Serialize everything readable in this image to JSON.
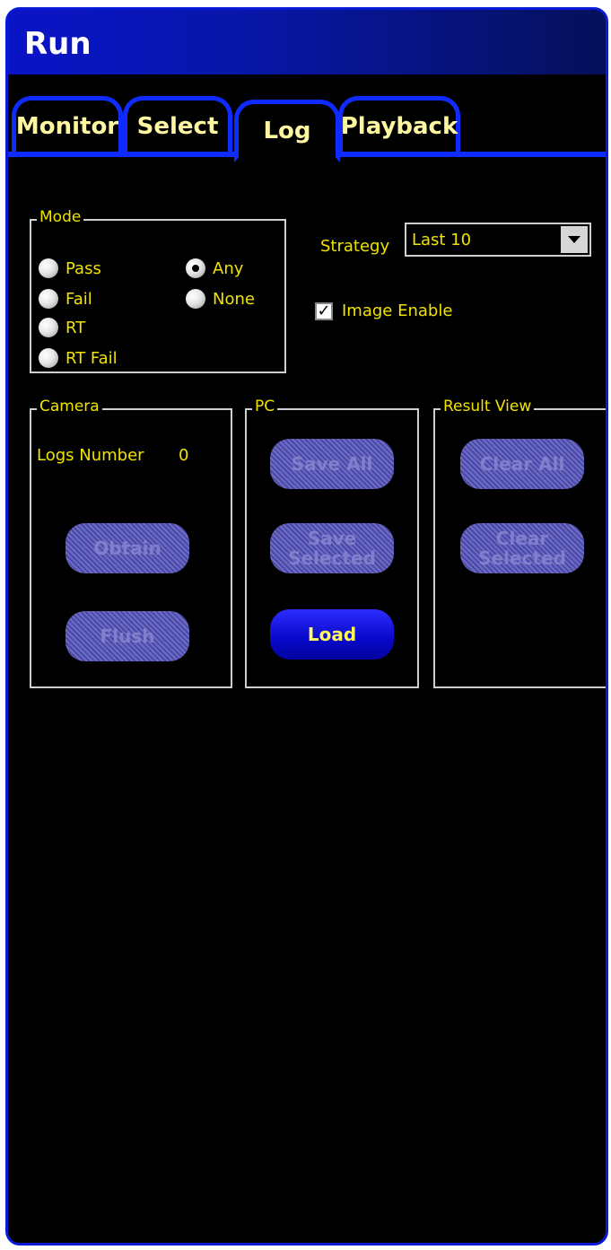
{
  "window": {
    "title": "Run"
  },
  "tabs": [
    {
      "label": "Monitor",
      "active": false
    },
    {
      "label": "Select",
      "active": false
    },
    {
      "label": "Log",
      "active": true
    },
    {
      "label": "Playback",
      "active": false
    }
  ],
  "mode": {
    "label": "Mode",
    "options": [
      {
        "label": "Pass",
        "selected": false
      },
      {
        "label": "Fail",
        "selected": false
      },
      {
        "label": "RT",
        "selected": false
      },
      {
        "label": "RT Fail",
        "selected": false
      },
      {
        "label": "Any",
        "selected": true
      },
      {
        "label": "None",
        "selected": false
      }
    ]
  },
  "strategy": {
    "label": "Strategy",
    "value": "Last 10"
  },
  "image_enable": {
    "label": "Image Enable",
    "checked": true
  },
  "camera": {
    "label": "Camera",
    "logs_number_label": "Logs Number",
    "logs_number_value": "0",
    "obtain_label": "Obtain",
    "flush_label": "Flush"
  },
  "pc": {
    "label": "PC",
    "save_all_label": "Save  All",
    "save_selected_label": "Save\nSelected",
    "load_label": "Load"
  },
  "result_view": {
    "label": "Result View",
    "clear_all_label": "Clear  All",
    "clear_selected_label": "Clear\nSelected"
  },
  "colors": {
    "accent": "#0f2bff",
    "text": "#f1e300",
    "background": "#000000"
  }
}
